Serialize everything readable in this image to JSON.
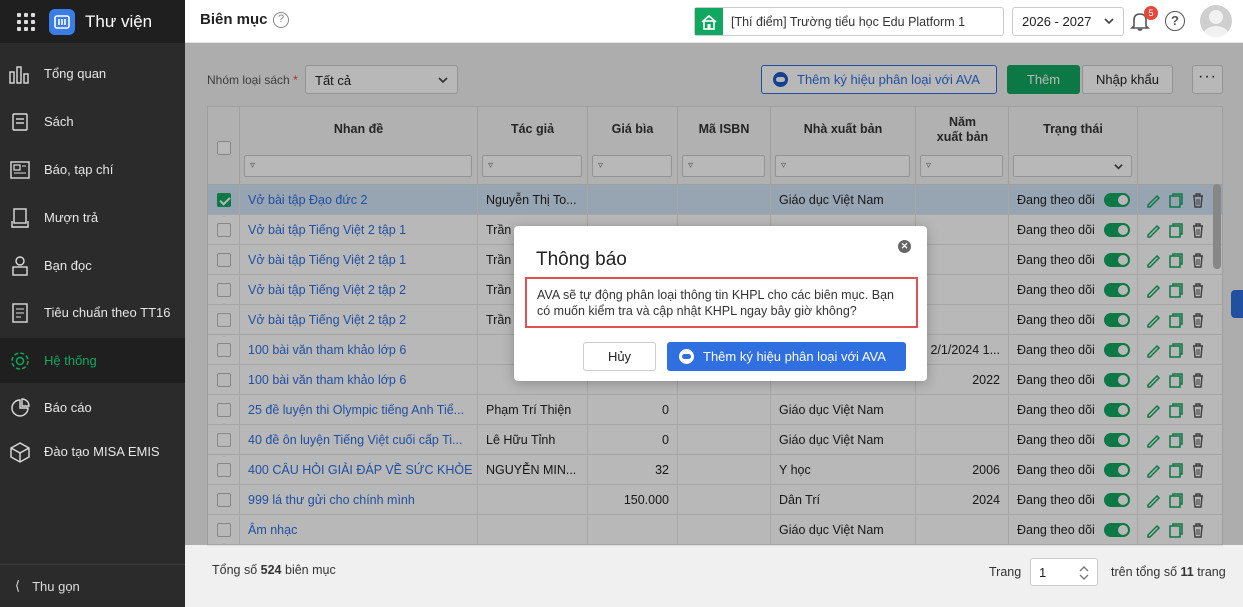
{
  "app": {
    "title": "Thư viện"
  },
  "header": {
    "page_title": "Biên mục",
    "school": "[Thí điểm] Trường tiểu học Edu Platform 1",
    "year": "2026 - 2027",
    "notification_count": "5"
  },
  "sidebar": {
    "items": [
      {
        "label": "Tổng quan",
        "icon": "dashboard-icon"
      },
      {
        "label": "Sách",
        "icon": "book-icon"
      },
      {
        "label": "Báo, tạp chí",
        "icon": "newspaper-icon"
      },
      {
        "label": "Mượn trả",
        "icon": "borrow-icon"
      },
      {
        "label": "Bạn đọc",
        "icon": "reader-icon"
      },
      {
        "label": "Tiêu chuẩn theo TT16",
        "icon": "standard-icon"
      },
      {
        "label": "Hệ thống",
        "icon": "gear-icon"
      },
      {
        "label": "Báo cáo",
        "icon": "report-icon"
      },
      {
        "label": "Đào tạo MISA EMIS",
        "icon": "training-icon"
      }
    ],
    "collapse_label": "Thu gọn",
    "active_color": "#10a760"
  },
  "toolbar": {
    "group_label": "Nhóm loại sách",
    "group_value": "Tất cả",
    "ava_button": "Thêm ký hiệu phân loại với AVA",
    "add_button": "Thêm",
    "import_button": "Nhập khẩu",
    "more_button": "···"
  },
  "table": {
    "columns": [
      "Nhan đề",
      "Tác giả",
      "Giá bìa",
      "Mã ISBN",
      "Nhà xuất bản",
      "Năm xuất bản",
      "Trạng thái"
    ],
    "rows": [
      {
        "title": "Vở bài tập Đạo đức 2",
        "author": "Nguyễn Thị To...",
        "price": "",
        "isbn": "",
        "publisher": "Giáo dục Việt Nam",
        "year": "",
        "status": "Đang theo dõi",
        "selected": true
      },
      {
        "title": "Vở bài tập Tiếng Việt 2 tập 1",
        "author": "Trần",
        "price": "",
        "isbn": "",
        "publisher": "",
        "year": "",
        "status": "Đang theo dõi",
        "selected": false
      },
      {
        "title": "Vở bài tập Tiếng Việt 2 tập 1",
        "author": "Trần",
        "price": "",
        "isbn": "",
        "publisher": "",
        "year": "",
        "status": "Đang theo dõi",
        "selected": false
      },
      {
        "title": "Vở bài tập Tiếng Việt 2 tập 2",
        "author": "Trần",
        "price": "",
        "isbn": "",
        "publisher": "",
        "year": "",
        "status": "Đang theo dõi",
        "selected": false
      },
      {
        "title": "Vở bài tập Tiếng Việt 2 tập 2",
        "author": "Trần",
        "price": "",
        "isbn": "",
        "publisher": "",
        "year": "",
        "status": "Đang theo dõi",
        "selected": false
      },
      {
        "title": "100 bài văn tham khảo lớp 6",
        "author": "",
        "price": "",
        "isbn": "",
        "publisher": "",
        "year": "2/1/2024 1...",
        "status": "Đang theo dõi",
        "selected": false
      },
      {
        "title": "100 bài văn tham khảo lớp 6",
        "author": "",
        "price": "",
        "isbn": "",
        "publisher": "",
        "year": "2022",
        "status": "Đang theo dõi",
        "selected": false
      },
      {
        "title": "25 đề luyện thi Olympic tiếng Anh Tiể...",
        "author": "Phạm Trí Thiện",
        "price": "0",
        "isbn": "",
        "publisher": "Giáo dục Việt Nam",
        "year": "",
        "status": "Đang theo dõi",
        "selected": false
      },
      {
        "title": "40 đề ôn luyện Tiếng Việt cuối cấp Ti...",
        "author": "Lê Hữu Tỉnh",
        "price": "0",
        "isbn": "",
        "publisher": "Giáo dục Việt Nam",
        "year": "",
        "status": "Đang theo dõi",
        "selected": false
      },
      {
        "title": "400 CÂU HỎI GIẢI ĐÁP VỀ SỨC KHỎE",
        "author": "NGUYỄN MIN...",
        "price": "32",
        "isbn": "",
        "publisher": "Y học",
        "year": "2006",
        "status": "Đang theo dõi",
        "selected": false
      },
      {
        "title": "999 lá thư gửi cho chính mình",
        "author": "",
        "price": "150.000",
        "isbn": "",
        "publisher": "Dân Trí",
        "year": "2024",
        "status": "Đang theo dõi",
        "selected": false
      },
      {
        "title": "Âm nhạc",
        "author": "",
        "price": "",
        "isbn": "",
        "publisher": "Giáo dục Việt Nam",
        "year": "",
        "status": "Đang theo dõi",
        "selected": false
      }
    ]
  },
  "footer": {
    "total_prefix": "Tổng số",
    "total_count": "524",
    "total_suffix": "biên mục",
    "page_label": "Trang",
    "page_value": "1",
    "pages_prefix": "trên tổng số",
    "pages_count": "11",
    "pages_suffix": "trang"
  },
  "modal": {
    "title": "Thông báo",
    "message": "AVA sẽ tự động phân loại thông tin KHPL cho các biên mục. Bạn có muốn kiểm tra và cập nhật KHPL ngay bây giờ không?",
    "cancel": "Hủy",
    "confirm": "Thêm ký hiệu phân loại với AVA"
  }
}
